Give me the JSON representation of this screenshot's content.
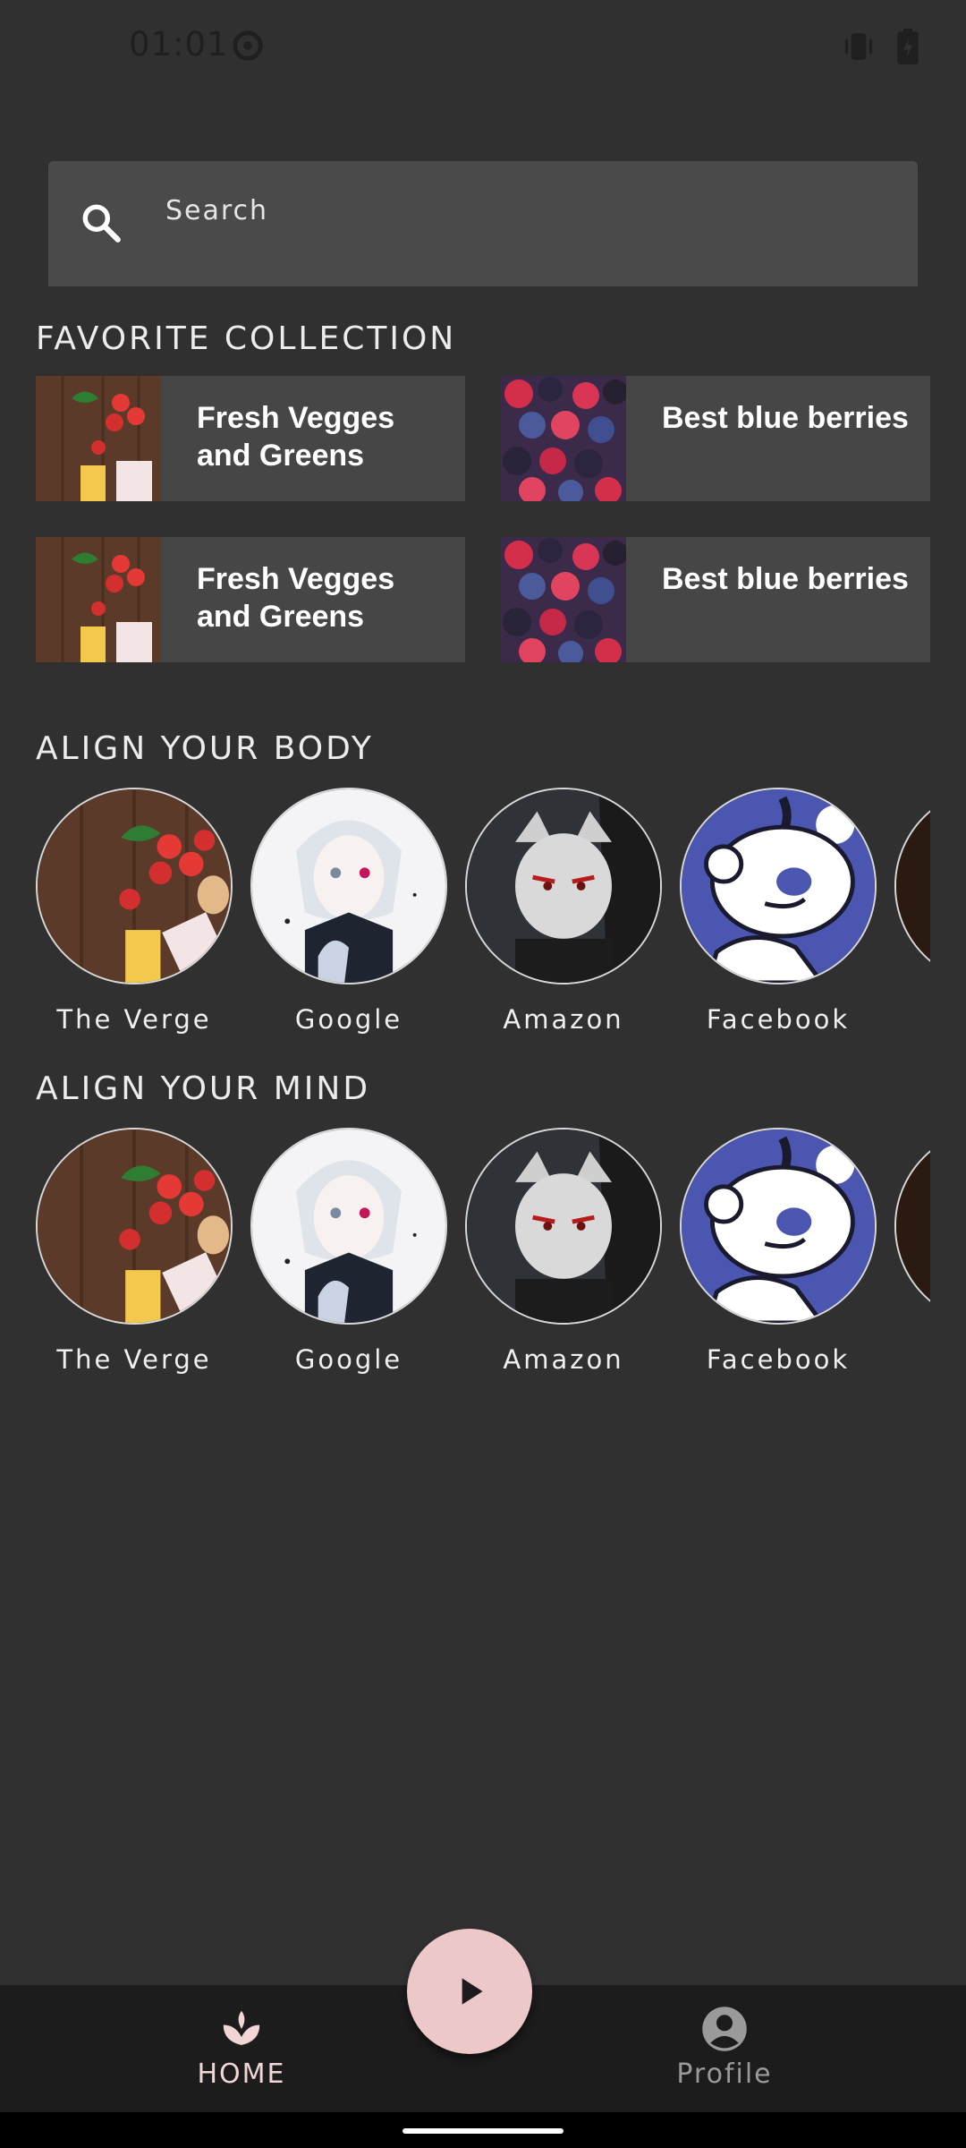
{
  "status_bar": {
    "time": "01:01"
  },
  "search": {
    "placeholder": "Search"
  },
  "favorite_collection": {
    "title": "FAVORITE COLLECTION",
    "items": [
      {
        "label": "Fresh Vegges and Greens",
        "image": "vegetables"
      },
      {
        "label": "Best blue berries",
        "image": "berries"
      },
      {
        "label": "Fresh Vegges and Greens",
        "image": "vegetables"
      },
      {
        "label": "Best blue berries",
        "image": "berries"
      }
    ]
  },
  "align_body": {
    "title": "ALIGN YOUR BODY",
    "items": [
      {
        "label": "The Verge",
        "image": "vegetables"
      },
      {
        "label": "Google",
        "image": "anime-white-hair"
      },
      {
        "label": "Amazon",
        "image": "anime-masked"
      },
      {
        "label": "Facebook",
        "image": "reddit-mascot"
      },
      {
        "label": "",
        "image": "fire-partial"
      }
    ]
  },
  "align_mind": {
    "title": "ALIGN YOUR MIND",
    "items": [
      {
        "label": "The Verge",
        "image": "vegetables"
      },
      {
        "label": "Google",
        "image": "anime-white-hair"
      },
      {
        "label": "Amazon",
        "image": "anime-masked"
      },
      {
        "label": "Facebook",
        "image": "reddit-mascot"
      },
      {
        "label": "",
        "image": "fire-partial"
      }
    ]
  },
  "bottom_nav": {
    "home_label": "HOME",
    "profile_label": "Profile",
    "active": "home"
  },
  "colors": {
    "background": "#303030",
    "card": "#464646",
    "fab": "#ecc8c8",
    "nav_active": "#f2d6d6",
    "nav_inactive": "#9a9a9a"
  }
}
